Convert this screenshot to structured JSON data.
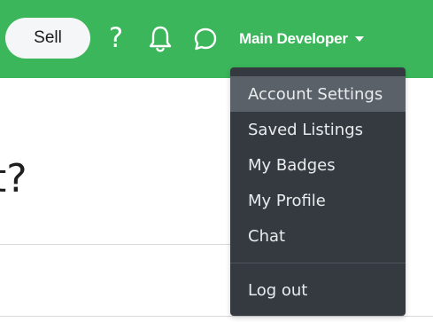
{
  "header": {
    "sell_label": "Sell",
    "help_glyph": "?",
    "user_name": "Main Developer",
    "icons": [
      "help-icon",
      "bell-icon",
      "chat-icon",
      "caret-down-icon"
    ],
    "bg_color": "#3bb65b"
  },
  "main": {
    "heading_partial": "t?"
  },
  "dropdown": {
    "items": [
      {
        "label": "Account Settings",
        "active": true
      },
      {
        "label": "Saved Listings"
      },
      {
        "label": "My Badges"
      },
      {
        "label": "My Profile"
      },
      {
        "label": "Chat"
      }
    ],
    "logout_label": "Log out",
    "bg_color": "#343a40",
    "active_bg": "#5a6168"
  }
}
